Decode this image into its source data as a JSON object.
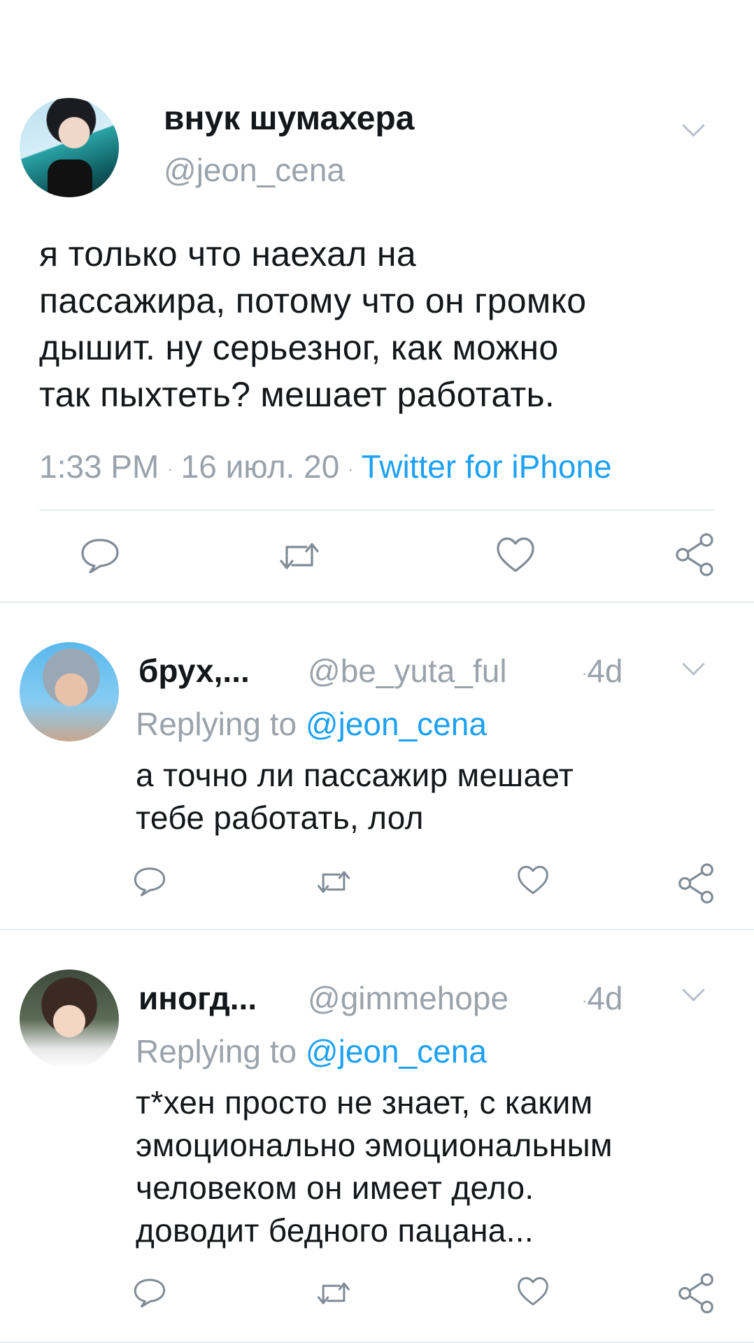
{
  "main_tweet": {
    "display_name": "внук шумахера",
    "handle": "@jeon_cena",
    "text": "я только что наехал на\nпассажира, потому что он громко\nдышит. ну серьезног, как можно\nтак пыхтеть? мешает работать.",
    "time": "1:33 PM",
    "date": "16 июл. 20",
    "source": "Twitter for iPhone",
    "separator": "·"
  },
  "replies": [
    {
      "display_name": "брух,...",
      "handle": "@be_yuta_ful",
      "time": "4d",
      "replying_prefix": "Replying to",
      "replying_to": "@jeon_cena",
      "text": "а точно ли пассажир мешает\nтебе работать, лол"
    },
    {
      "display_name": "иногд...",
      "handle": "@gimmehope",
      "time": "4d",
      "replying_prefix": "Replying to",
      "replying_to": "@jeon_cena",
      "text": "т*хен просто не знает, с каким\nэмоционально эмоциональным\nчеловеком он имеет дело.\nдоводит бедного пацана..."
    }
  ],
  "icons": {
    "reply": "reply-icon",
    "retweet": "retweet-icon",
    "like": "like-icon",
    "share": "share-icon",
    "menu": "chevron-down-icon"
  },
  "colors": {
    "text": "#14171a",
    "secondary": "#9aa3ab",
    "link": "#1da1f2",
    "divider": "#e6ecf0",
    "icon": "#7f8b96"
  }
}
